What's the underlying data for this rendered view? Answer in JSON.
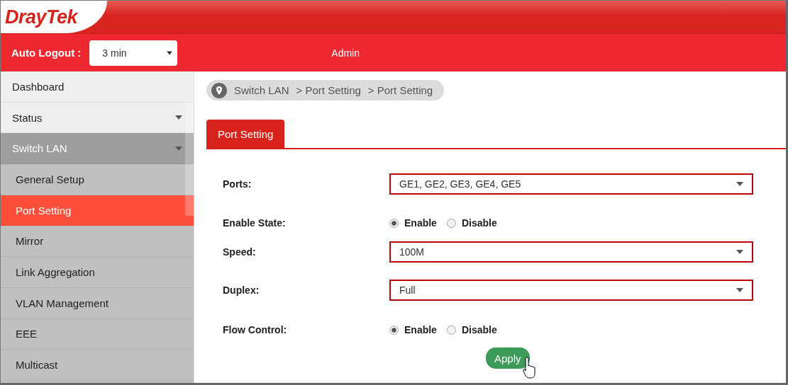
{
  "logo": "DrayTek",
  "header": {
    "auto_logout_label": "Auto Logout :",
    "auto_logout_value": "3 min",
    "user": "Admin"
  },
  "sidebar": {
    "items": [
      {
        "label": "Dashboard",
        "kind": "link",
        "selected": false
      },
      {
        "label": "Status",
        "kind": "group",
        "expanded": false,
        "selected": false
      },
      {
        "label": "Switch LAN",
        "kind": "group",
        "expanded": true,
        "selected": false,
        "children": [
          {
            "label": "General Setup",
            "selected": false
          },
          {
            "label": "Port Setting",
            "selected": true
          },
          {
            "label": "Mirror",
            "selected": false
          },
          {
            "label": "Link Aggregation",
            "selected": false
          },
          {
            "label": "VLAN Management",
            "selected": false
          },
          {
            "label": "EEE",
            "selected": false
          },
          {
            "label": "Multicast",
            "selected": false
          }
        ]
      }
    ]
  },
  "breadcrumb": [
    "Switch LAN",
    "> Port Setting",
    "> Port Setting"
  ],
  "tabs": [
    {
      "label": "Port Setting",
      "selected": true
    }
  ],
  "form": [
    {
      "kind": "select",
      "label": "Ports:",
      "value": "GE1, GE2, GE3, GE4, GE5"
    },
    {
      "kind": "radio",
      "label": "Enable State:",
      "options": [
        {
          "label": "Enable",
          "selected": true
        },
        {
          "label": "Disable",
          "selected": false
        }
      ]
    },
    {
      "kind": "select",
      "label": "Speed:",
      "value": "100M"
    },
    {
      "kind": "select",
      "label": "Duplex:",
      "value": "Full"
    },
    {
      "kind": "radio",
      "label": "Flow Control:",
      "options": [
        {
          "label": "Enable",
          "selected": true
        },
        {
          "label": "Disable",
          "selected": false
        }
      ]
    }
  ],
  "apply_button": "Apply"
}
